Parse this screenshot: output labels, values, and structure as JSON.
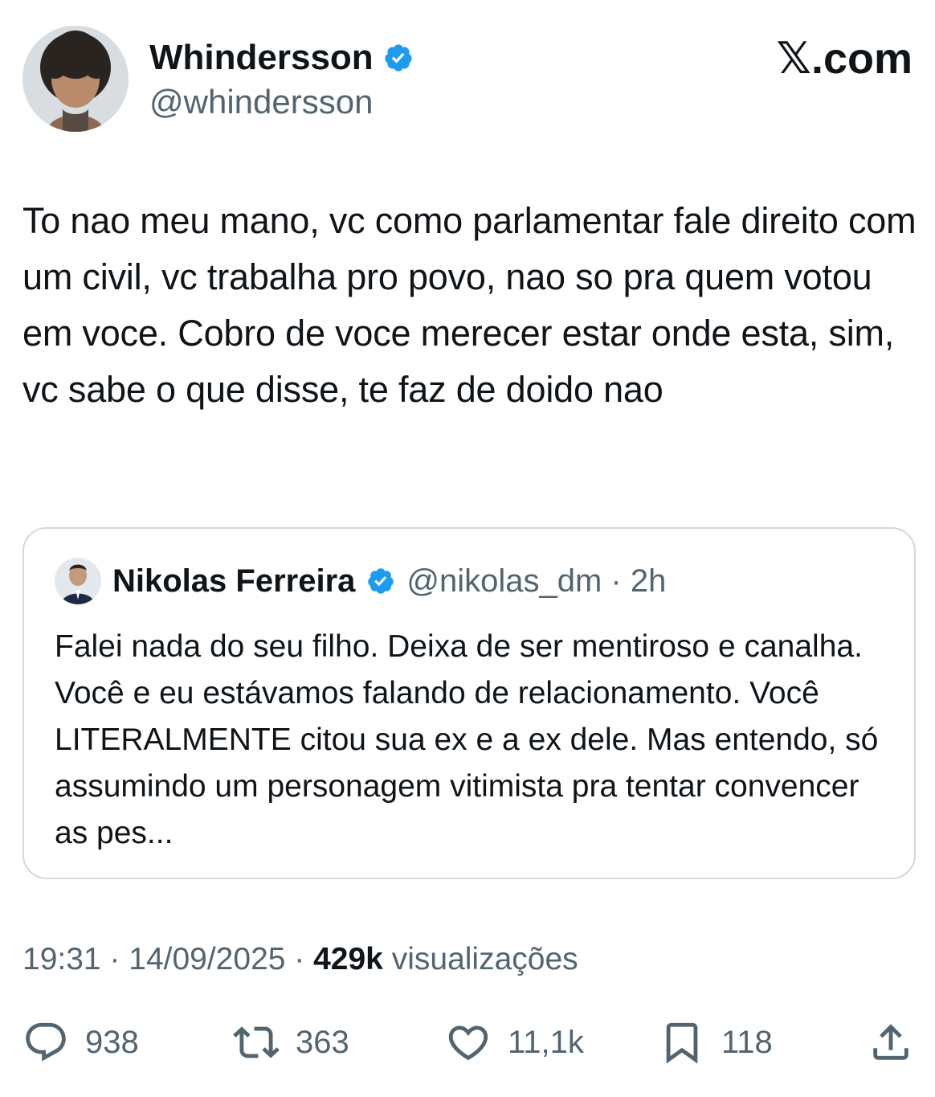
{
  "author": {
    "name": "Whindersson",
    "handle": "@whindersson",
    "verified": true,
    "avatar_icon": "user-avatar"
  },
  "site_label": "𝕏.com",
  "tweet": {
    "text": "To nao meu mano, vc como parlamentar fale direito com um civil, vc trabalha pro povo, nao so pra quem votou em voce. Cobro de voce merecer estar onde esta, sim, vc sabe o que disse, te faz de doido nao"
  },
  "quoted": {
    "name": "Nikolas Ferreira",
    "handle_time": "@nikolas_dm · 2h",
    "verified": true,
    "text": "Falei nada do seu filho. Deixa de ser mentiroso e canalha. Você e eu estávamos falando de relacionamento. Você LITERALMENTE citou sua ex e a ex dele. Mas entendo, só assumindo um personagem vitimista pra tentar convencer as pes..."
  },
  "meta": {
    "time_date": "19:31 · 14/09/2025 · ",
    "views_count": "429k",
    "views_label": " visualizações"
  },
  "actions": {
    "replies": "938",
    "reposts": "363",
    "likes": "11,1k",
    "bookmarks": "118"
  },
  "colors": {
    "text": "#0f1419",
    "secondary": "#536471",
    "verified_blue": "#1d9bf0",
    "border": "#cfd9de"
  }
}
